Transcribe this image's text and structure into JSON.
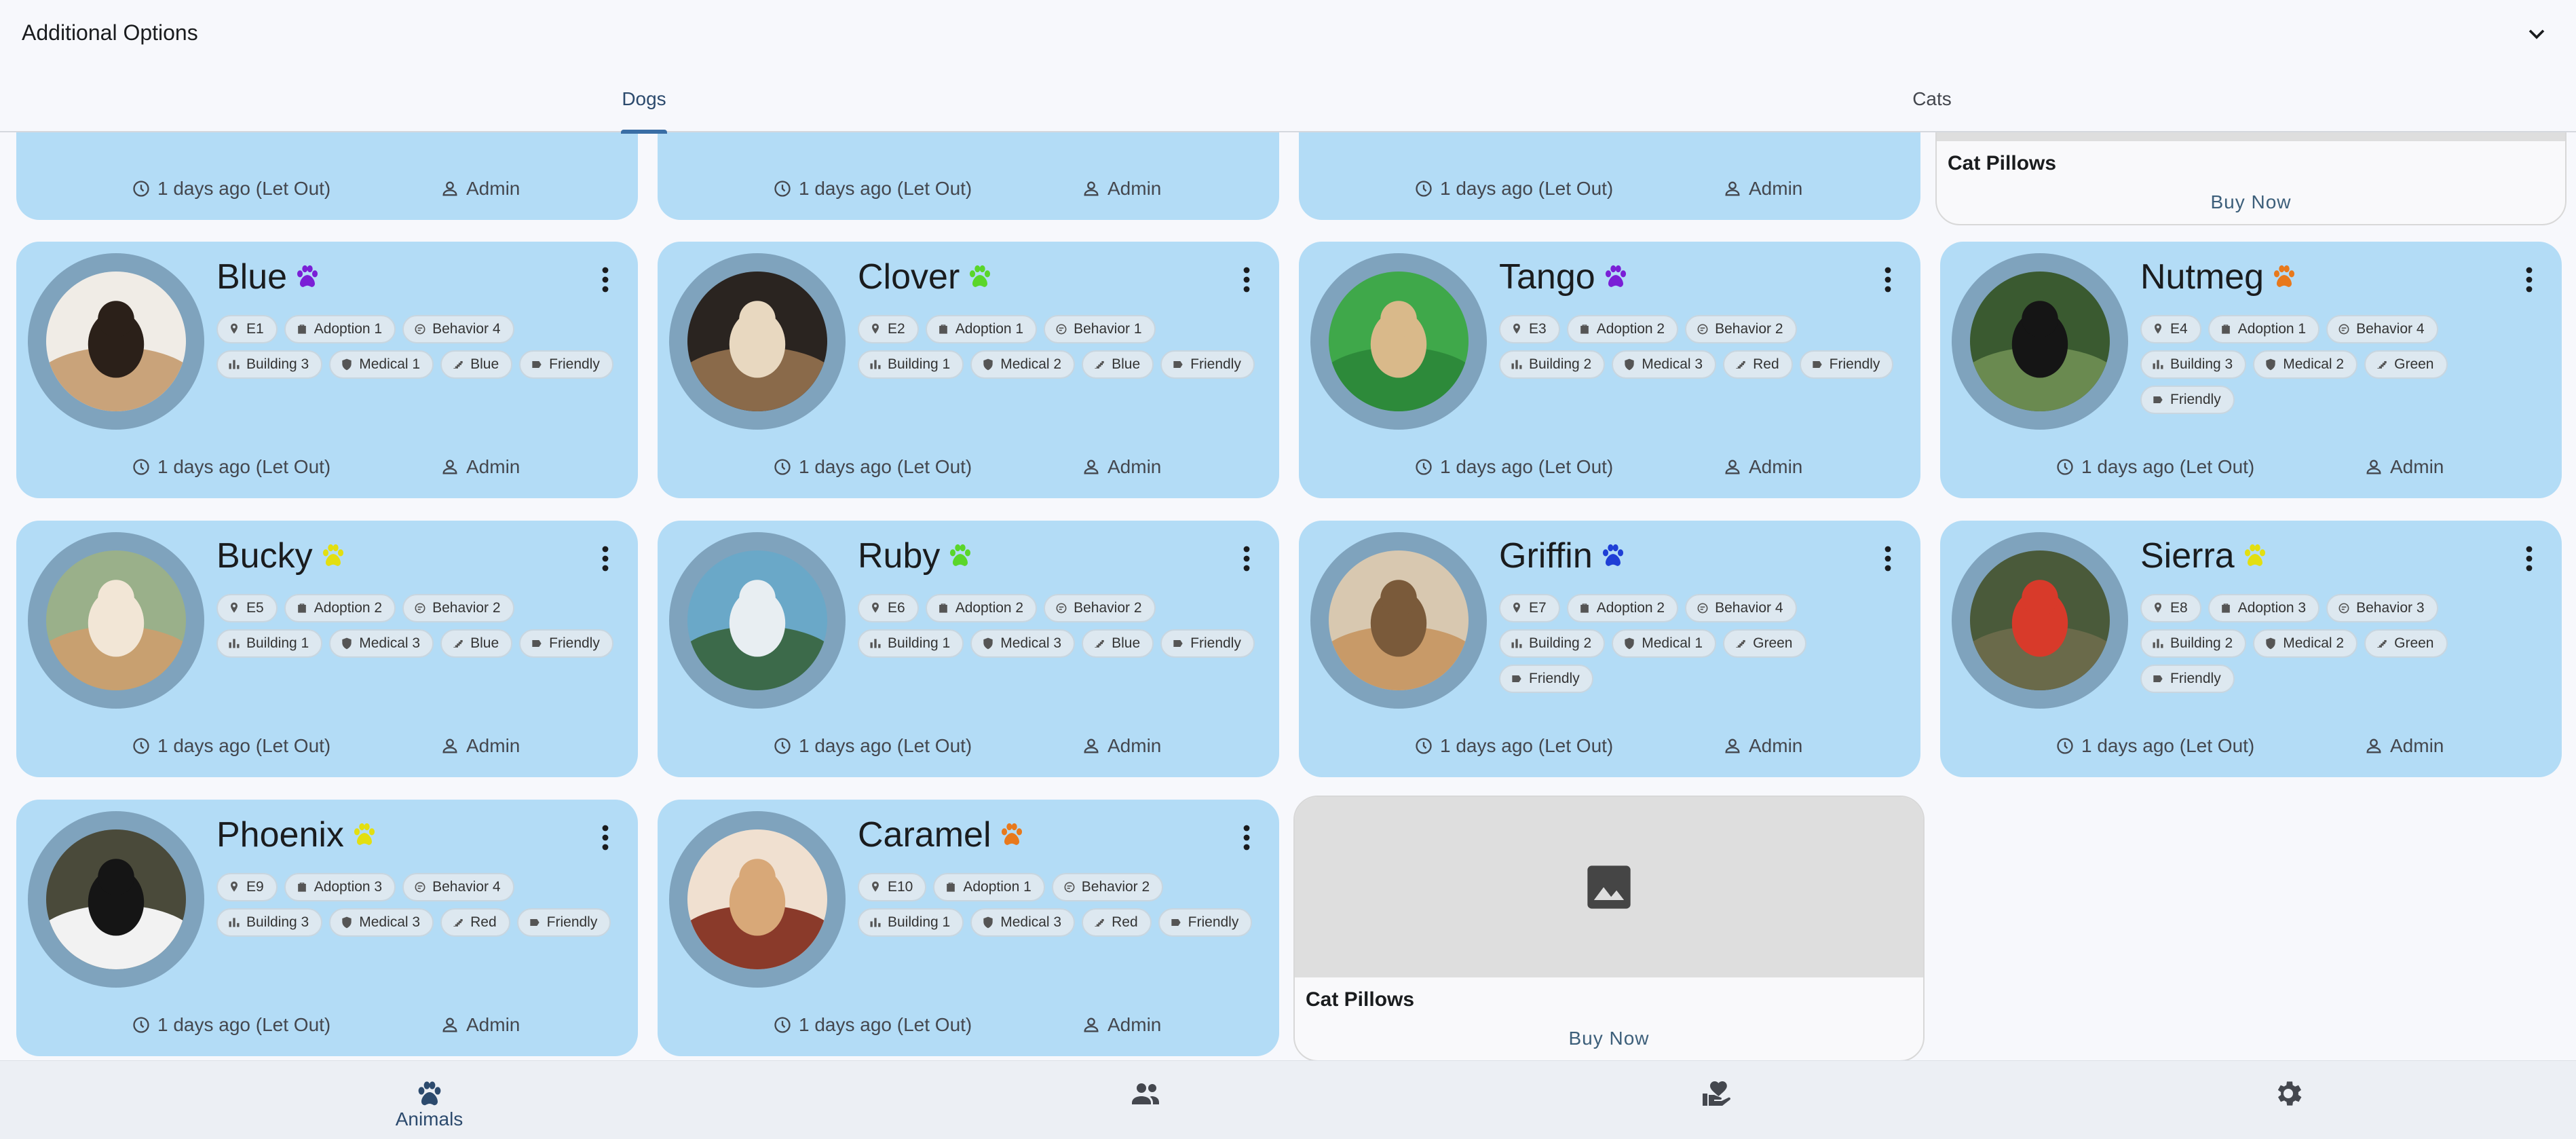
{
  "header": {
    "title": "Additional Options"
  },
  "tabs": [
    {
      "label": "Dogs",
      "active": true
    },
    {
      "label": "Cats",
      "active": false
    }
  ],
  "footer_defaults": {
    "time": "1 days ago (Let Out)",
    "user": "Admin"
  },
  "partial_top_row": [
    {
      "time": "1 days ago (Let Out)",
      "user": "Admin"
    },
    {
      "time": "1 days ago (Let Out)",
      "user": "Admin"
    },
    {
      "time": "1 days ago (Let Out)",
      "user": "Admin"
    }
  ],
  "promo_top": {
    "title": "Cat Pillows",
    "button": "Buy Now"
  },
  "animals": [
    {
      "name": "Blue",
      "paw_color": "#7a1fd6",
      "chips": [
        "E1",
        "Adoption 1",
        "Behavior 4",
        "Building 3",
        "Medical 1",
        "Blue",
        "Friendly"
      ],
      "time": "1 days ago (Let Out)",
      "user": "Admin"
    },
    {
      "name": "Clover",
      "paw_color": "#5ad62a",
      "chips": [
        "E2",
        "Adoption 1",
        "Behavior 1",
        "Building 1",
        "Medical 2",
        "Blue",
        "Friendly"
      ],
      "time": "1 days ago (Let Out)",
      "user": "Admin"
    },
    {
      "name": "Tango",
      "paw_color": "#7a1fd6",
      "chips": [
        "E3",
        "Adoption 2",
        "Behavior 2",
        "Building 2",
        "Medical 3",
        "Red",
        "Friendly"
      ],
      "time": "1 days ago (Let Out)",
      "user": "Admin"
    },
    {
      "name": "Nutmeg",
      "paw_color": "#e8791c",
      "chips": [
        "E4",
        "Adoption 1",
        "Behavior 4",
        "Building 3",
        "Medical 2",
        "Green",
        "Friendly"
      ],
      "time": "1 days ago (Let Out)",
      "user": "Admin"
    },
    {
      "name": "Bucky",
      "paw_color": "#e3df10",
      "chips": [
        "E5",
        "Adoption 2",
        "Behavior 2",
        "Building 1",
        "Medical 3",
        "Blue",
        "Friendly"
      ],
      "time": "1 days ago (Let Out)",
      "user": "Admin"
    },
    {
      "name": "Ruby",
      "paw_color": "#5ad62a",
      "chips": [
        "E6",
        "Adoption 2",
        "Behavior 2",
        "Building 1",
        "Medical 3",
        "Blue",
        "Friendly"
      ],
      "time": "1 days ago (Let Out)",
      "user": "Admin"
    },
    {
      "name": "Griffin",
      "paw_color": "#1f3fd6",
      "chips": [
        "E7",
        "Adoption 2",
        "Behavior 4",
        "Building 2",
        "Medical 1",
        "Green",
        "Friendly"
      ],
      "time": "1 days ago (Let Out)",
      "user": "Admin"
    },
    {
      "name": "Sierra",
      "paw_color": "#e3df10",
      "chips": [
        "E8",
        "Adoption 3",
        "Behavior 3",
        "Building 2",
        "Medical 2",
        "Green",
        "Friendly"
      ],
      "time": "1 days ago (Let Out)",
      "user": "Admin"
    },
    {
      "name": "Phoenix",
      "paw_color": "#e3df10",
      "chips": [
        "E9",
        "Adoption 3",
        "Behavior 4",
        "Building 3",
        "Medical 3",
        "Red",
        "Friendly"
      ],
      "time": "1 days ago (Let Out)",
      "user": "Admin"
    },
    {
      "name": "Caramel",
      "paw_color": "#e8791c",
      "chips": [
        "E10",
        "Adoption 1",
        "Behavior 2",
        "Building 1",
        "Medical 3",
        "Red",
        "Friendly"
      ],
      "time": "1 days ago (Let Out)",
      "user": "Admin"
    }
  ],
  "promo_bottom": {
    "title": "Cat Pillows",
    "button": "Buy Now"
  },
  "bottom_nav": [
    {
      "label": "Animals",
      "icon": "paw-icon"
    },
    {
      "label": "",
      "icon": "people-icon"
    },
    {
      "label": "",
      "icon": "volunteer-icon"
    },
    {
      "label": "",
      "icon": "settings-icon"
    }
  ]
}
